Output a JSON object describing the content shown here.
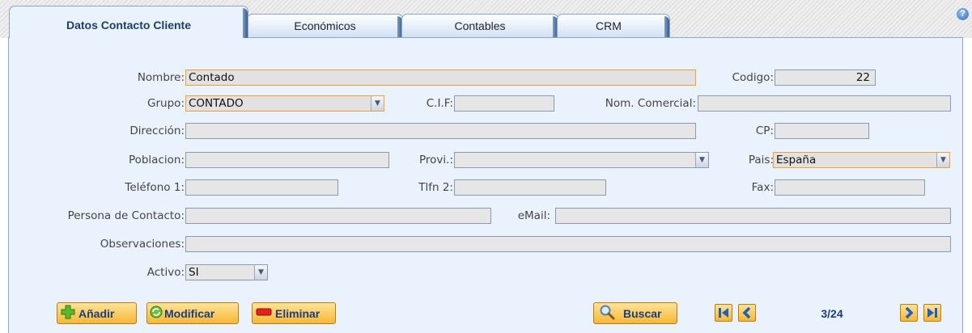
{
  "tabs": [
    {
      "label": "Datos Contacto Cliente"
    },
    {
      "label": "Económicos"
    },
    {
      "label": "Contables"
    },
    {
      "label": "CRM"
    }
  ],
  "help": {
    "glyph": "?"
  },
  "form": {
    "nombre": {
      "label": "Nombre:",
      "value": "Contado"
    },
    "codigo": {
      "label": "Codigo:",
      "value": "22"
    },
    "grupo": {
      "label": "Grupo:",
      "value": "CONTADO"
    },
    "cif": {
      "label": "C.I.F:",
      "value": ""
    },
    "nom_comercial": {
      "label": "Nom. Comercial:",
      "value": ""
    },
    "direccion": {
      "label": "Dirección:",
      "value": ""
    },
    "cp": {
      "label": "CP:",
      "value": ""
    },
    "poblacion": {
      "label": "Poblacion:",
      "value": ""
    },
    "provincia": {
      "label": "Provi.:",
      "value": ""
    },
    "pais": {
      "label": "Pais:",
      "value": "España"
    },
    "telefono1": {
      "label": "Teléfono 1:",
      "value": ""
    },
    "tlfn2": {
      "label": "Tlfn 2:",
      "value": ""
    },
    "fax": {
      "label": "Fax:",
      "value": ""
    },
    "persona_contacto": {
      "label": "Persona de Contacto:",
      "value": ""
    },
    "email": {
      "label": "eMail:",
      "value": ""
    },
    "observaciones": {
      "label": "Observaciones:",
      "value": ""
    },
    "activo": {
      "label": "Activo:",
      "value": "SI"
    }
  },
  "buttons": {
    "anadir": "Añadir",
    "modificar": "Modificar",
    "eliminar": "Eliminar",
    "buscar": "Buscar"
  },
  "navigation": {
    "counter": "3/24"
  },
  "colors": {
    "panel_bg": "#eaf3fd",
    "field_bg": "#e6e6e6",
    "selected_border": "#f0a030",
    "button_gradient_top": "#fde49a",
    "button_gradient_bottom": "#f7b733",
    "button_text": "#1d3d80",
    "nav_arrow": "#1f5fbf"
  },
  "icons": {
    "anadir": "plus-icon",
    "modificar": "refresh-icon",
    "eliminar": "minus-icon",
    "buscar": "magnifier-icon",
    "first": "first-record-icon",
    "prev": "previous-record-icon",
    "next": "next-record-icon",
    "last": "last-record-icon"
  }
}
